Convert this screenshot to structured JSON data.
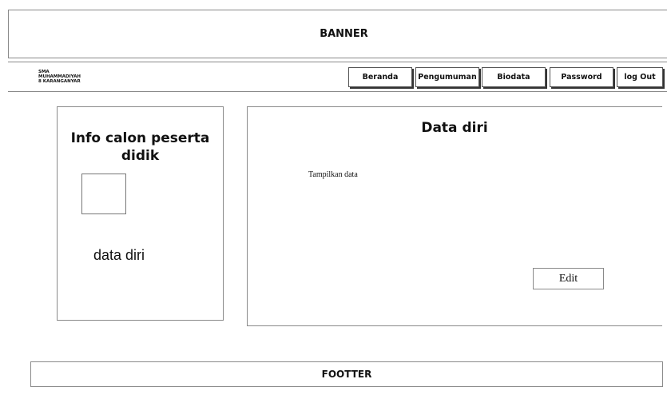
{
  "banner": {
    "label": "BANNER"
  },
  "school": {
    "line1": "SMA",
    "line2": "MUHAMMADIYAH",
    "line3": "8 KARANGANYAR"
  },
  "nav": {
    "items": [
      {
        "label": "Beranda"
      },
      {
        "label": "Pengumuman"
      },
      {
        "label": "Biodata"
      },
      {
        "label": "Password"
      },
      {
        "label": "log Out"
      }
    ]
  },
  "sidebar": {
    "title": "Info calon peserta didik",
    "link": "data diri"
  },
  "main": {
    "title": "Data diri",
    "content": "Tampilkan data",
    "edit_label": "Edit"
  },
  "footer": {
    "label": "FOOTTER"
  }
}
